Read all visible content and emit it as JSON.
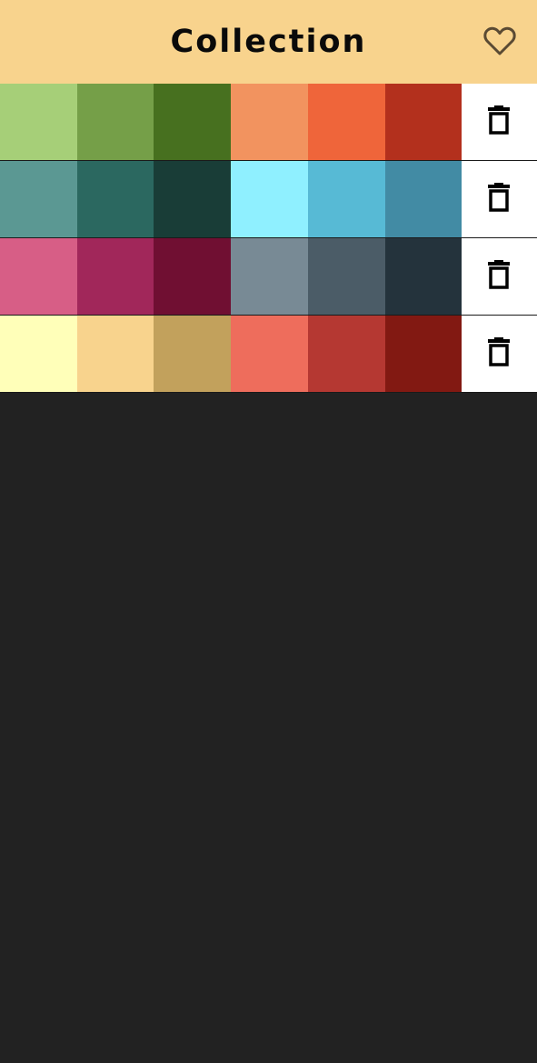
{
  "header": {
    "title": "Collection",
    "favorite_icon": "heart-outline-icon"
  },
  "palettes": [
    {
      "colors": [
        "#a6cf78",
        "#759f48",
        "#47701f",
        "#f2935f",
        "#ef653a",
        "#b3301d"
      ],
      "delete_icon": "trash-icon"
    },
    {
      "colors": [
        "#5b9893",
        "#2b6860",
        "#193d37",
        "#8ff0ff",
        "#57bad5",
        "#428ba4"
      ],
      "delete_icon": "trash-icon"
    },
    {
      "colors": [
        "#d75e86",
        "#a1275a",
        "#700f32",
        "#788a95",
        "#4b5c67",
        "#24333c"
      ],
      "delete_icon": "trash-icon"
    },
    {
      "colors": [
        "#ffffb9",
        "#f8d38d",
        "#c2a15c",
        "#ee6d5c",
        "#b53832",
        "#821912"
      ],
      "delete_icon": "trash-icon"
    }
  ],
  "colors": {
    "header_bg": "#f8d38d",
    "page_bg": "#222222",
    "row_action_bg": "#ffffff"
  }
}
